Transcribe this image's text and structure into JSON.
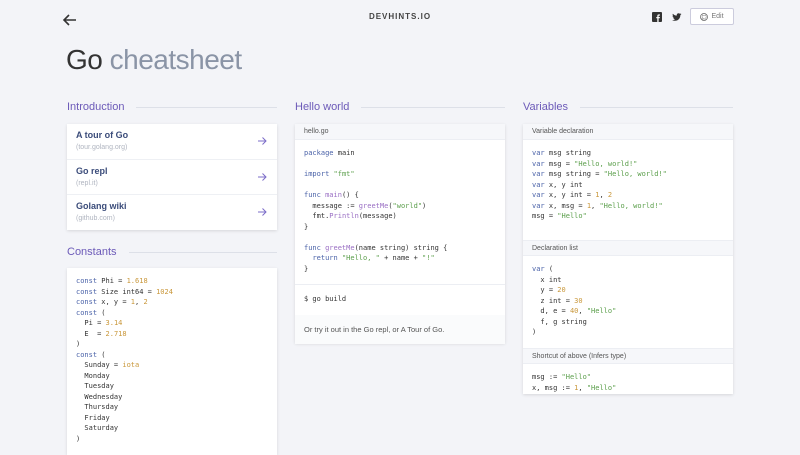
{
  "header": {
    "brand": "DEVHINTS.IO",
    "edit_label": "Edit"
  },
  "title": {
    "main": "Go",
    "light": "cheatsheet"
  },
  "sections": {
    "introduction": "Introduction",
    "constants": "Constants",
    "hello_world": "Hello world",
    "variables": "Variables"
  },
  "intro_links": [
    {
      "title": "A tour of Go",
      "sub": "(tour.golang.org)"
    },
    {
      "title": "Go repl",
      "sub": "(repl.it)"
    },
    {
      "title": "Golang wiki",
      "sub": "(github.com)"
    }
  ],
  "hello": {
    "file": "hello.go",
    "command": "$ go build",
    "note": "Or try it out in the Go repl, or A Tour of Go."
  },
  "variables": {
    "decl_head": "Variable declaration",
    "list_head": "Declaration list",
    "short_head": "Shortcut of above (Infers type)"
  },
  "colors": {
    "accent": "#6c5ab8",
    "link": "#3b4c7a",
    "bg": "#f3f4f8"
  },
  "icons": [
    "back-arrow-icon",
    "facebook-icon",
    "twitter-icon",
    "github-icon",
    "arrow-right-icon"
  ]
}
